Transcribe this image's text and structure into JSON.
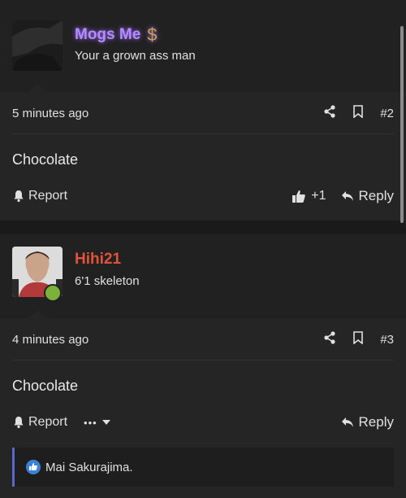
{
  "posts": [
    {
      "username": "Mogs Me",
      "username_color": "#b48cff",
      "badge": "$",
      "user_title": "Your a grown ass man",
      "time": "5 minutes ago",
      "post_number": "#2",
      "content": "Chocolate",
      "report_label": "Report",
      "like_count": "+1",
      "reply_label": "Reply"
    },
    {
      "username": "Hihi21",
      "username_color": "#e0533a",
      "user_title": "6'1 skeleton",
      "time": "4 minutes ago",
      "post_number": "#3",
      "content": "Chocolate",
      "report_label": "Report",
      "more_label": "•••",
      "reply_label": "Reply",
      "reaction_user": "Mai Sakurajima."
    }
  ],
  "accent_color": "#5a67c8",
  "online_color": "#7bb33a",
  "icons": [
    "share-icon",
    "bookmark-icon",
    "bell-icon",
    "thumbs-up-icon",
    "reply-arrow-icon",
    "caret-down-icon",
    "like-badge-icon",
    "dollar-icon"
  ]
}
